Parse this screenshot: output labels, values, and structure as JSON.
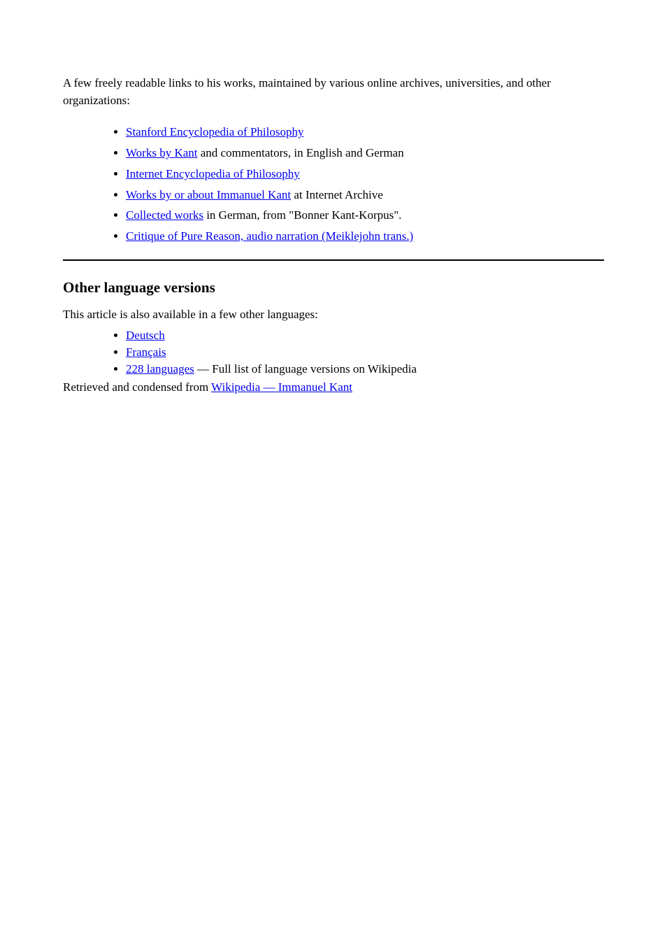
{
  "intro": "A few freely readable links to his works, maintained by various online archives, universities, and other organizations:",
  "profile_links": [
    {
      "label": "Stanford Encyclopedia of Philosophy",
      "trail": ""
    },
    {
      "label": "Works by Kant",
      "trail": " and commentators, in English and German"
    },
    {
      "label": "Internet Encyclopedia of Philosophy",
      "trail": ""
    },
    {
      "label": "Works by or about Immanuel Kant",
      "trail": " at Internet Archive"
    },
    {
      "label": "Collected works",
      "trail": " in German, from \"Bonner Kant-Korpus\"."
    },
    {
      "label": "Critique of Pure Reason, audio narration (Meiklejohn trans.)",
      "trail": ""
    }
  ],
  "section_heading": "Other language versions",
  "lang_intro": "This article is also available in a few other languages:",
  "languages": [
    {
      "label": "Deutsch",
      "trail": ""
    },
    {
      "label": "Français",
      "trail": ""
    },
    {
      "label": "228 languages",
      "trail": " — Full list of language versions on Wikipedia"
    }
  ],
  "retrieved": {
    "prefix": "Retrieved and condensed from ",
    "link_text": "Wikipedia — Immanuel Kant"
  }
}
